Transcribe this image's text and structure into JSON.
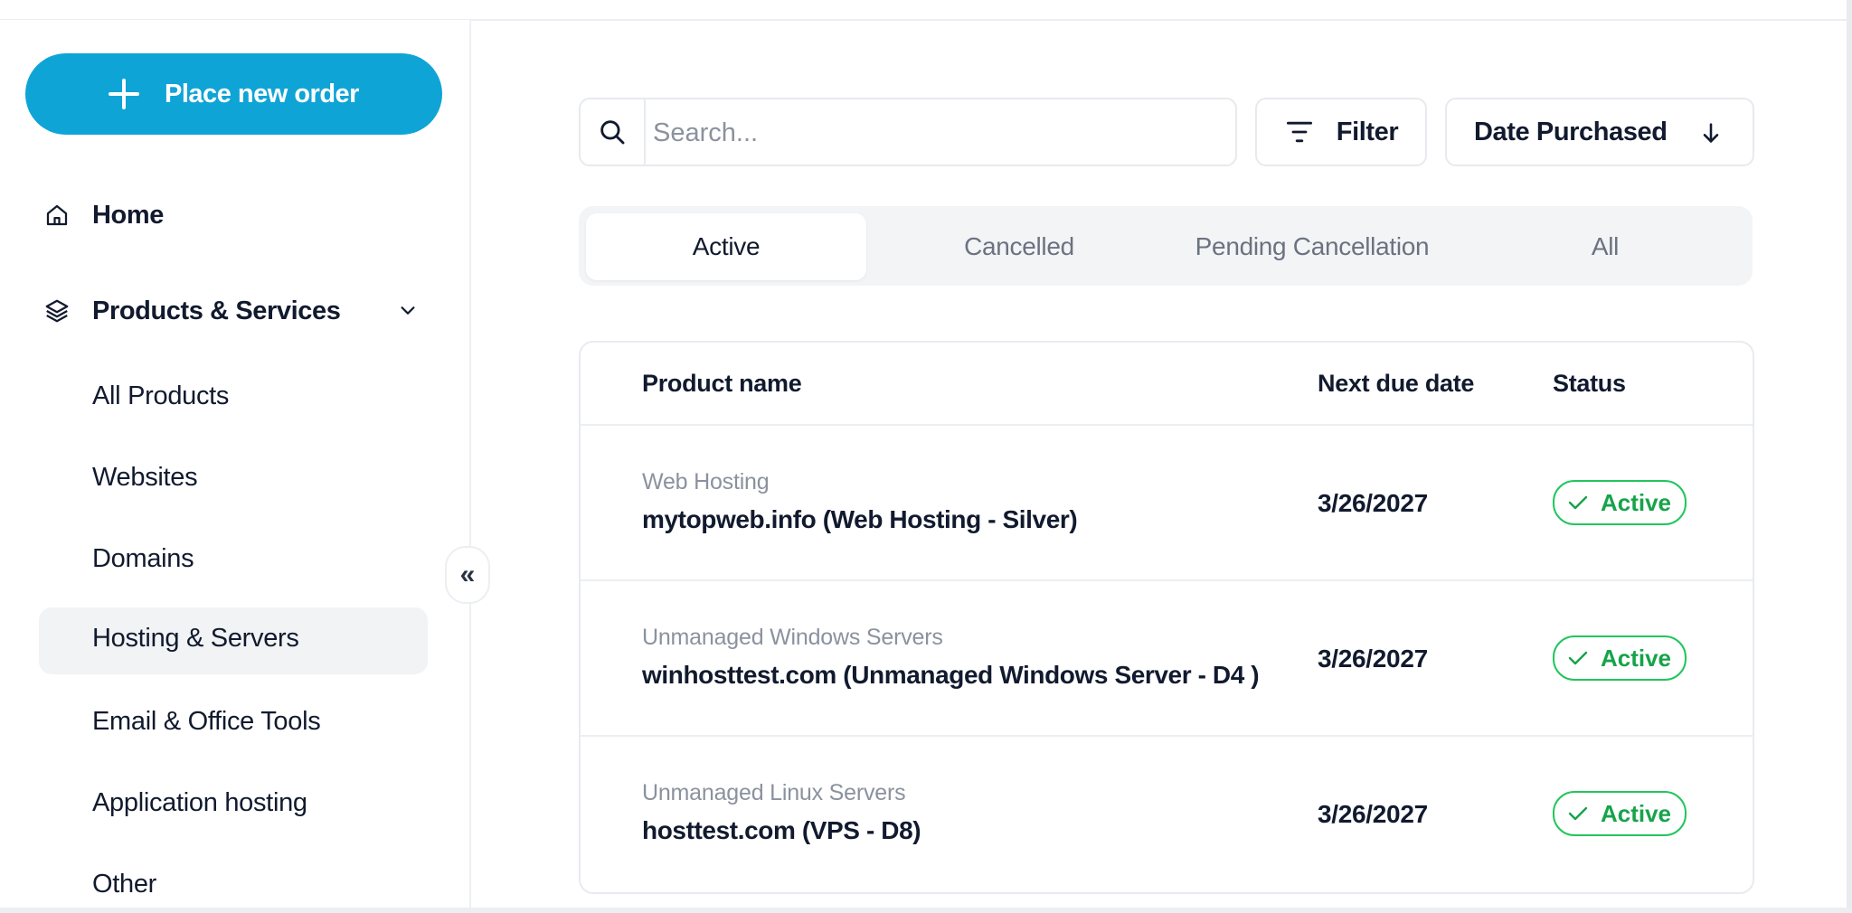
{
  "sidebar": {
    "new_order_label": "Place new order",
    "home_label": "Home",
    "products_label": "Products & Services",
    "items": [
      {
        "label": "All Products"
      },
      {
        "label": "Websites"
      },
      {
        "label": "Domains"
      },
      {
        "label": "Hosting & Servers",
        "active": true
      },
      {
        "label": "Email & Office Tools"
      },
      {
        "label": "Application hosting"
      },
      {
        "label": "Other"
      }
    ],
    "collapse_label": "«"
  },
  "toolbar": {
    "search_placeholder": "Search...",
    "filter_label": "Filter",
    "sort_label": "Date Purchased"
  },
  "tabs": [
    {
      "label": "Active",
      "selected": true
    },
    {
      "label": "Cancelled"
    },
    {
      "label": "Pending Cancellation"
    },
    {
      "label": "All"
    }
  ],
  "table": {
    "columns": [
      "Product name",
      "Next due date",
      "Status"
    ],
    "rows": [
      {
        "category": "Web Hosting",
        "name": "mytopweb.info (Web Hosting - Silver)",
        "due": "3/26/2027",
        "status": "Active"
      },
      {
        "category": "Unmanaged Windows Servers",
        "name": "winhosttest.com (Unmanaged Windows Server - D4 )",
        "due": "3/26/2027",
        "status": "Active"
      },
      {
        "category": "Unmanaged Linux Servers",
        "name": "hosttest.com (VPS - D8)",
        "due": "3/26/2027",
        "status": "Active"
      }
    ]
  },
  "colors": {
    "accent": "#0fa4d6",
    "status_active": "#22c55e",
    "text": "#111a2e"
  }
}
